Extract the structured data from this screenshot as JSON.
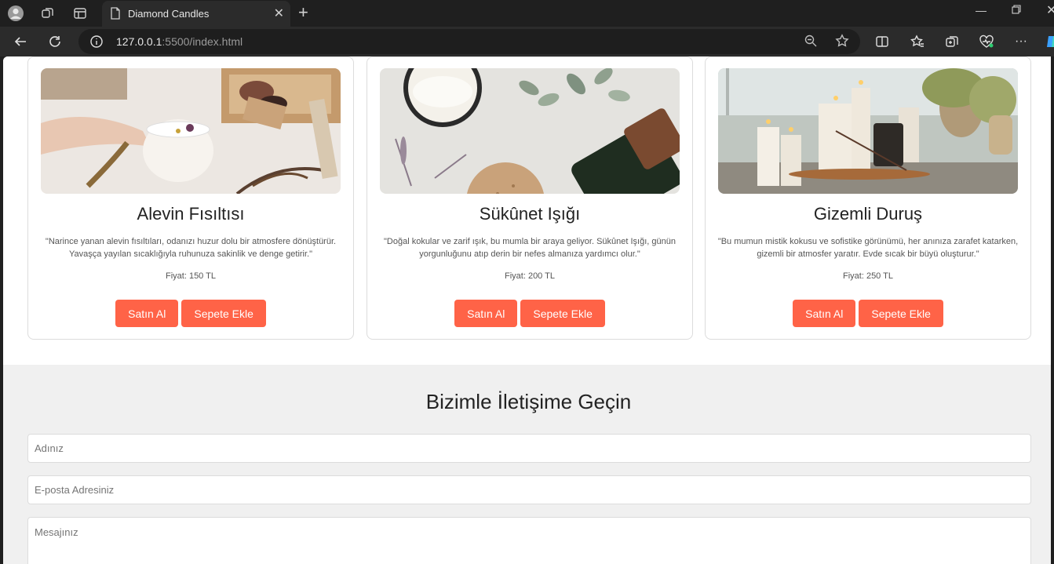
{
  "browser": {
    "tab_title": "Diamond Candles",
    "url_host": "127.0.0.1",
    "url_rest": ":5500/index.html"
  },
  "products": [
    {
      "name": "Alevin Fısıltısı",
      "description": "\"Narince yanan alevin fısıltıları, odanızı huzur dolu bir atmosfere dönüştürür. Yavaşça yayılan sıcaklığıyla ruhunuza sakinlik ve denge getirir.\"",
      "price": "Fiyat: 150 TL",
      "buy_label": "Satın Al",
      "cart_label": "Sepete Ekle"
    },
    {
      "name": "Sükûnet Işığı",
      "description": "\"Doğal kokular ve zarif ışık, bu mumla bir araya geliyor. Sükûnet Işığı, günün yorgunluğunu atıp derin bir nefes almanıza yardımcı olur.\"",
      "price": "Fiyat: 200 TL",
      "buy_label": "Satın Al",
      "cart_label": "Sepete Ekle"
    },
    {
      "name": "Gizemli Duruş",
      "description": "\"Bu mumun mistik kokusu ve sofistike görünümü, her anınıza zarafet katarken, gizemli bir atmosfer yaratır. Evde sıcak bir büyü oluşturur.\"",
      "price": "Fiyat: 250 TL",
      "buy_label": "Satın Al",
      "cart_label": "Sepete Ekle"
    }
  ],
  "contact": {
    "title": "Bizimle İletişime Geçin",
    "name_placeholder": "Adınız",
    "email_placeholder": "E-posta Adresiniz",
    "message_placeholder": "Mesajınız"
  },
  "colors": {
    "accent": "#ff6347",
    "section_bg": "#f0f0f0"
  }
}
